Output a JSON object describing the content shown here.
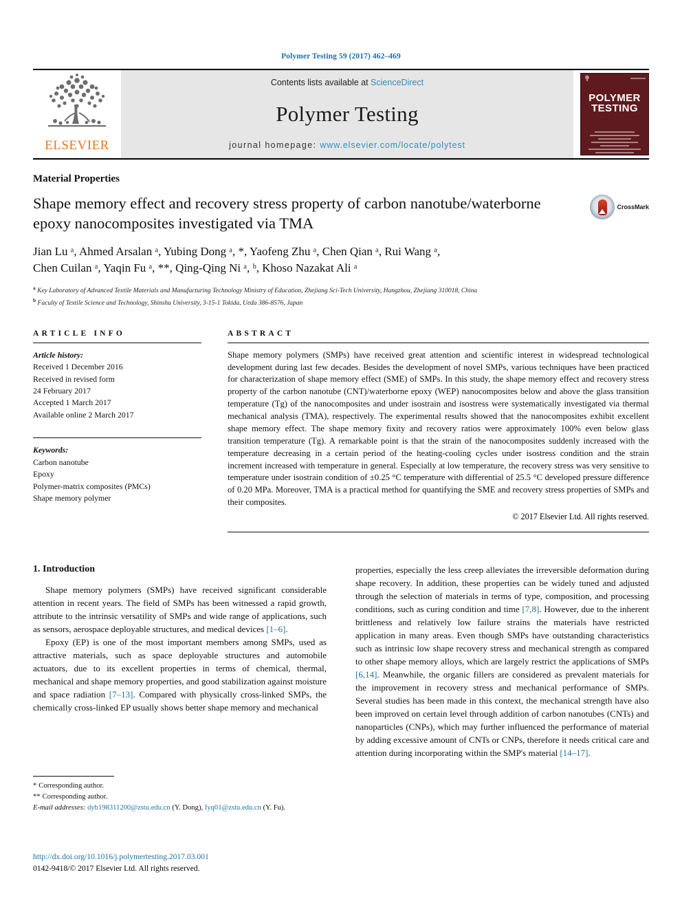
{
  "running_head": "Polymer Testing 59 (2017) 462–469",
  "masthead": {
    "publisher_name": "ELSEVIER",
    "contents_prefix": "Contents lists available at ",
    "contents_link": "ScienceDirect",
    "journal_title": "Polymer Testing",
    "homepage_prefix": "journal homepage: ",
    "homepage_url": "www.elsevier.com/locate/polytest",
    "cover_title_line1": "POLYMER",
    "cover_title_line2": "TESTING"
  },
  "article": {
    "section_label": "Material Properties",
    "title": "Shape memory effect and recovery stress property of carbon nanotube/waterborne epoxy nanocomposites investigated via TMA",
    "crossmark_label": "CrossMark",
    "authors_line1": "Jian Lu ᵃ, Ahmed Arsalan ᵃ, Yubing Dong ᵃ, *, Yaofeng Zhu ᵃ, Chen Qian ᵃ, Rui Wang ᵃ,",
    "authors_line2": "Chen Cuilan ᵃ, Yaqin Fu ᵃ, **, Qing-Qing Ni ᵃ, ᵇ, Khoso Nazakat Ali ᵃ",
    "affiliation_a": "Key Laboratory of Advanced Textile Materials and Manufacturing Technology Ministry of Education, Zhejiang Sci-Tech University, Hangzhou, Zhejiang 310018, China",
    "affiliation_b": "Faculty of Textile Science and Technology, Shinshu University, 3-15-1 Tokida, Ueda 386-8576, Japan"
  },
  "article_info": {
    "heading": "ARTICLE INFO",
    "history_label": "Article history:",
    "history": [
      "Received 1 December 2016",
      "Received in revised form",
      "24 February 2017",
      "Accepted 1 March 2017",
      "Available online 2 March 2017"
    ],
    "keywords_label": "Keywords:",
    "keywords": [
      "Carbon nanotube",
      "Epoxy",
      "Polymer-matrix composites (PMCs)",
      "Shape memory polymer"
    ]
  },
  "abstract": {
    "heading": "ABSTRACT",
    "text": "Shape memory polymers (SMPs) have received great attention and scientific interest in widespread technological development during last few decades. Besides the development of novel SMPs, various techniques have been practiced for characterization of shape memory effect (SME) of SMPs. In this study, the shape memory effect and recovery stress property of the carbon nanotube (CNT)/waterborne epoxy (WEP) nanocomposites below and above the glass transition temperature (Tg) of the nanocomposites and under isostrain and isostress were systematically investigated via thermal mechanical analysis (TMA), respectively. The experimental results showed that the nanocomposites exhibit excellent shape memory effect. The shape memory fixity and recovery ratios were approximately 100% even below glass transition temperature (Tg). A remarkable point is that the strain of the nanocomposites suddenly increased with the temperature decreasing in a certain period of the heating-cooling cycles under isostress condition and the strain increment increased with temperature in general. Especially at low temperature, the recovery stress was very sensitive to temperature under isostrain condition of ±0.25 °C temperature with differential of 25.5 °C developed pressure difference of 0.20 MPa. Moreover, TMA is a practical method for quantifying the SME and recovery stress properties of SMPs and their composites.",
    "copyright": "© 2017 Elsevier Ltd. All rights reserved."
  },
  "introduction": {
    "heading": "1. Introduction",
    "left_paragraph_1_a": "Shape memory polymers (SMPs) have received significant considerable attention in recent years. The field of SMPs has been witnessed a rapid growth, attribute to the intrinsic versatility of SMPs and wide range of applications, such as sensors, aerospace deployable structures, and medical devices ",
    "left_paragraph_1_cite": "[1–6]",
    "left_paragraph_1_b": ".",
    "left_paragraph_2_a": "Epoxy (EP) is one of the most important members among SMPs, used as attractive materials, such as space deployable structures and automobile actuators, due to its excellent properties in terms of chemical, thermal, mechanical and shape memory properties, and good stabilization against moisture and space radiation ",
    "left_paragraph_2_cite": "[7–13]",
    "left_paragraph_2_b": ". Compared with physically cross-linked SMPs, the chemically cross-linked EP usually shows better shape memory and mechanical",
    "right_paragraph_a": "properties, especially the less creep alleviates the irreversible deformation during shape recovery. In addition, these properties can be widely tuned and adjusted through the selection of materials in terms of type, composition, and processing conditions, such as curing condition and time ",
    "right_cite_1": "[7,8]",
    "right_paragraph_b": ". However, due to the inherent brittleness and relatively low failure strains the materials have restricted application in many areas. Even though SMPs have outstanding characteristics such as intrinsic low shape recovery stress and mechanical strength as compared to other shape memory alloys, which are largely restrict the applications of SMPs ",
    "right_cite_2": "[6,14]",
    "right_paragraph_c": ". Meanwhile, the organic fillers are considered as prevalent materials for the improvement in recovery stress and mechanical performance of SMPs. Several studies has been made in this context, the mechanical strength have also been improved on certain level through addition of carbon nanotubes (CNTs) and nanoparticles (CNPs), which may further influenced the performance of material by adding excessive amount of CNTs or CNPs, therefore it needs critical care and attention during incorporating within the SMP's material ",
    "right_cite_3": "[14–17]",
    "right_paragraph_d": "."
  },
  "footnotes": {
    "corresponding_1": "Corresponding author.",
    "corresponding_2": "Corresponding author.",
    "email_label": "E-mail addresses:",
    "email_1": "dyb198311200@zstu.edu.cn",
    "email_1_owner": "(Y. Dong),",
    "email_2": "fyq01@zstu.edu.cn",
    "email_2_owner": "(Y. Fu)."
  },
  "footer": {
    "doi": "http://dx.doi.org/10.1016/j.polymertesting.2017.03.001",
    "issn_line": "0142-9418/© 2017 Elsevier Ltd. All rights reserved."
  },
  "colors": {
    "link_blue": "#1a72a8",
    "sciencedirect_blue": "#2a8fc4",
    "elsevier_orange": "#E87722",
    "cover_maroon": "#5e1a1e",
    "masthead_grey": "#e6e6e6"
  }
}
